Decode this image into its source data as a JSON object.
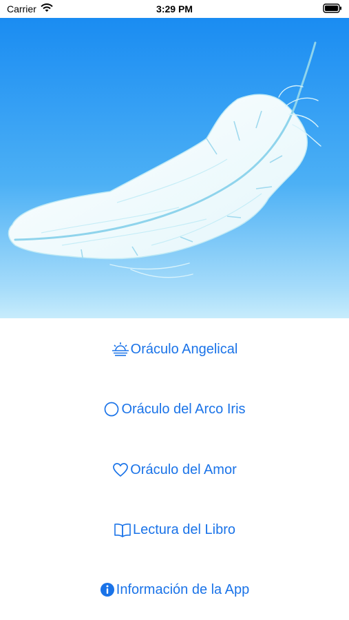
{
  "status_bar": {
    "carrier": "Carrier",
    "time": "3:29 PM"
  },
  "hero": {
    "image": "feather-illustration"
  },
  "colors": {
    "accent": "#1a73e8",
    "sky_top": "#1a8cf2",
    "sky_bottom": "#c7ecfc"
  },
  "menu": {
    "items": [
      {
        "label": "Oráculo Angelical",
        "icon": "sunrise-icon"
      },
      {
        "label": "Oráculo del Arco Iris",
        "icon": "circle-icon"
      },
      {
        "label": "Oráculo del Amor",
        "icon": "heart-icon"
      },
      {
        "label": "Lectura del Libro",
        "icon": "book-icon"
      },
      {
        "label": "Información de la App",
        "icon": "info-icon"
      }
    ]
  }
}
